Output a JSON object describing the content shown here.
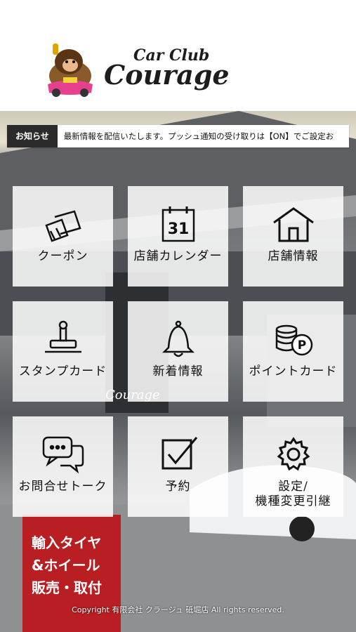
{
  "brand": {
    "line1": "Car Club",
    "line2": "Courage"
  },
  "news": {
    "tag": "お知らせ",
    "text": "最新情報を配信いたします。プッシュ通知の受け取りは【ON】でご設定お"
  },
  "menu": [
    {
      "label": "クーポン",
      "icon": "coupon-icon"
    },
    {
      "label": "店舗カレンダー",
      "icon": "calendar-icon",
      "calendar_day": "31"
    },
    {
      "label": "店舗情報",
      "icon": "store-icon"
    },
    {
      "label": "スタンプカード",
      "icon": "stamp-icon"
    },
    {
      "label": "新着情報",
      "icon": "bell-icon"
    },
    {
      "label": "ポイントカード",
      "icon": "points-icon",
      "points_badge": "P"
    },
    {
      "label": "お問合せトーク",
      "icon": "chat-icon"
    },
    {
      "label": "予約",
      "icon": "checkbox-icon"
    },
    {
      "label": "設定/\n機種変更引継",
      "icon": "gear-icon"
    }
  ],
  "background": {
    "sign_text": "輸入タイヤ\n&ホイール\n販売・取付",
    "wall_logo": "Courage"
  },
  "footer": {
    "copyright": "Copyright 有限会社 クラージュ 砥堀店 All rights reserved."
  }
}
